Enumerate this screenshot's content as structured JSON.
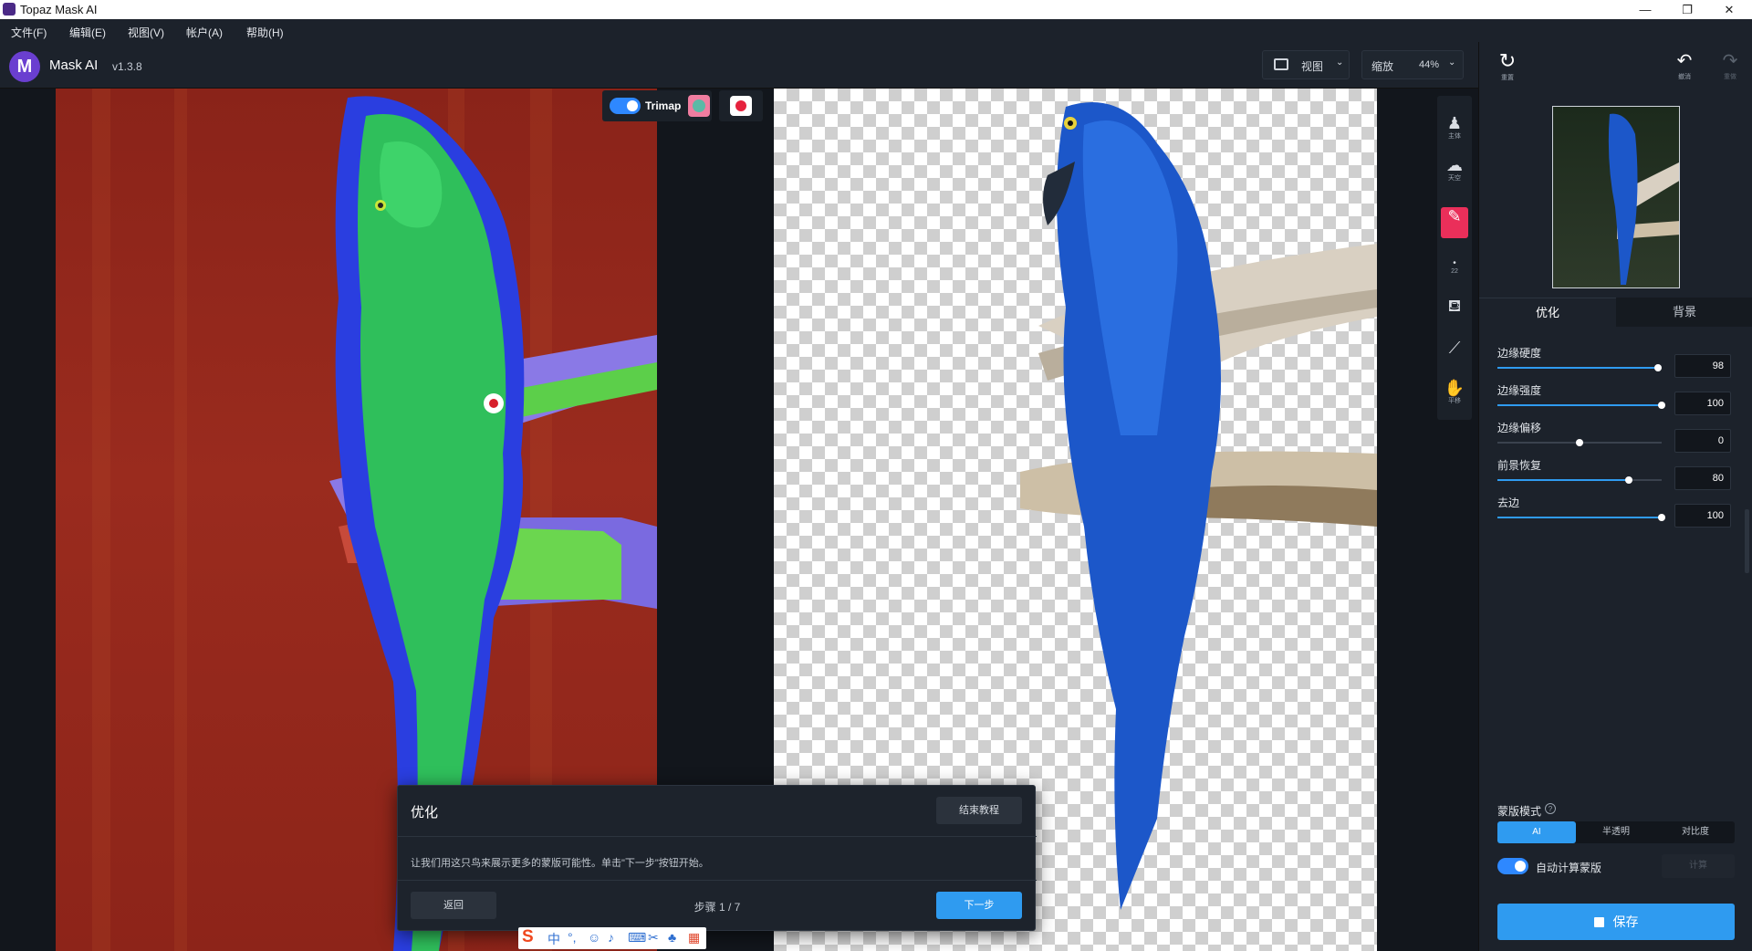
{
  "window": {
    "title": "Topaz Mask AI",
    "min": "—",
    "max": "❐",
    "close": "✕"
  },
  "menu": [
    "文件(F)",
    "编辑(E)",
    "视图(V)",
    "帐户(A)",
    "帮助(H)"
  ],
  "app": {
    "name": "Mask AI",
    "version": "v1.3.8",
    "logo_letter": "M"
  },
  "toolbar": {
    "view_label": "视图",
    "zoom_label": "缩放",
    "zoom_value": "44%"
  },
  "trimap": {
    "label": "Trimap",
    "enabled": true
  },
  "tools": [
    {
      "icon": "subject-icon",
      "label": "主体"
    },
    {
      "icon": "sky-icon",
      "label": "天空"
    },
    {
      "icon": "brush-icon",
      "label": ""
    },
    {
      "icon": "brush-size-icon",
      "label": "22"
    },
    {
      "icon": "fill-bucket-icon",
      "label": ""
    },
    {
      "icon": "eyedropper-icon",
      "label": ""
    },
    {
      "icon": "pan-hand-icon",
      "label": "平移"
    }
  ],
  "right_panel": {
    "reset_label": "重置",
    "undo_label": "撤消",
    "redo_label": "重做",
    "tabs": [
      "优化",
      "背景"
    ],
    "active_tab": "优化",
    "sliders": [
      {
        "label": "边缘硬度",
        "value": "98",
        "fraction": 0.98
      },
      {
        "label": "边缘强度",
        "value": "100",
        "fraction": 1.0
      },
      {
        "label": "边缘偏移",
        "value": "0",
        "fraction": 0.5
      },
      {
        "label": "前景恢复",
        "value": "80",
        "fraction": 0.8
      },
      {
        "label": "去边",
        "value": "100",
        "fraction": 1.0
      }
    ],
    "mask_mode": {
      "label": "蒙版模式",
      "help": "?",
      "options": [
        "AI",
        "半透明",
        "对比度"
      ],
      "selected": "AI"
    },
    "auto_compute": {
      "label": "自动计算蒙版",
      "enabled": true,
      "compute_button": "计算"
    },
    "save_button": "保存"
  },
  "tutorial": {
    "title": "优化",
    "end_button": "结束教程",
    "body": "让我们用这只鸟来展示更多的蒙版可能性。单击\"下一步\"按钮开始。",
    "back_button": "返回",
    "step": "步骤 1 / 7",
    "next_button": "下一步"
  },
  "ime": {
    "logo": "S",
    "mode": "中"
  },
  "colors": {
    "accent": "#2f9bf0",
    "active_tool": "#ea2f5a",
    "bg": "#12161c",
    "panel": "#1c222b"
  }
}
